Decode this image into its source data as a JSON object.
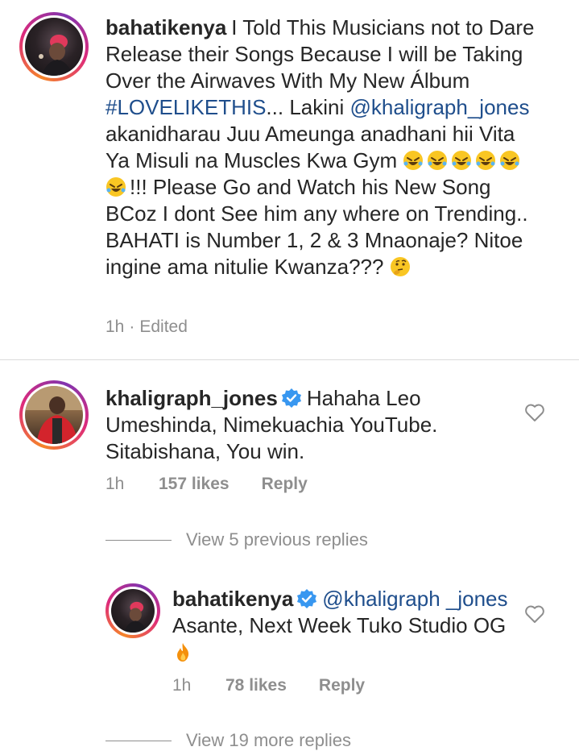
{
  "post": {
    "username": "bahatikenya",
    "text_a": "I Told This Musicians not to Dare Release their Songs Because I will be Taking Over the Airwaves With My New Álbum ",
    "hashtag": "#LOVELIKETHIS",
    "text_b": "... Lakini ",
    "mention": "@khaligraph_jones",
    "text_c": " akanidharau Juu Ameunga anadhani hii Vita Ya Misuli na Muscles Kwa Gym ",
    "text_d": "!!! Please Go and Watch his New Song BCoz I dont See him any where on Trending.. BAHATI is Number 1, 2 & 3 Mnaonaje? Nitoe ingine ama nitulie Kwanza??? ",
    "emoji_laugh": "rolling-on-floor-laughing-emoji",
    "emoji_think": "thinking-face-emoji",
    "time": "1h",
    "separator": "·",
    "edited": "Edited"
  },
  "comments": [
    {
      "username": "khaligraph_jones",
      "verified": true,
      "text": "Hahaha Leo Umeshinda, Nimekuachia YouTube. Sitabishana, You win.",
      "time": "1h",
      "likes": "157 likes",
      "reply": "Reply",
      "view_replies": "View 5 previous replies"
    }
  ],
  "reply": {
    "username": "bahatikenya",
    "verified": true,
    "mention": "@khaligraph _jones",
    "text": " Asante, Next Week Tuko Studio OG ",
    "emoji": "fire-emoji",
    "time": "1h",
    "likes": "78 likes",
    "reply": "Reply",
    "view_more": "View 19 more replies"
  },
  "colors": {
    "text": "#262626",
    "meta": "#8e8e8e",
    "link": "#1f4e8c",
    "verified": "#3897f0",
    "divider": "#dbdbdb"
  }
}
